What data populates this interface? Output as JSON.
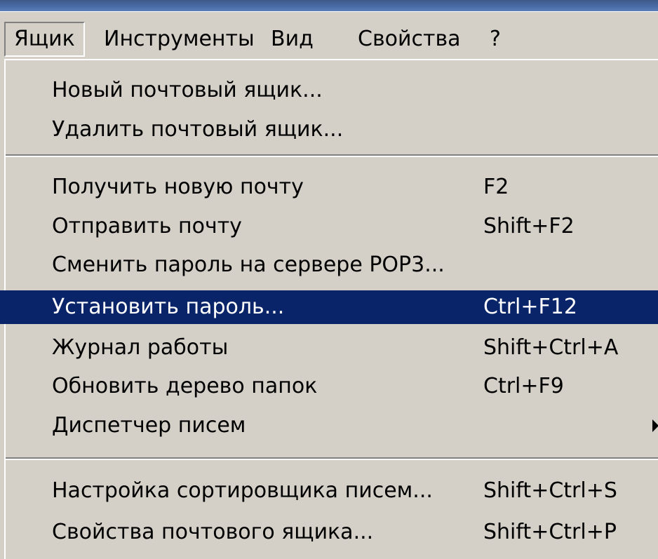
{
  "menubar": {
    "items": [
      {
        "label": "Ящик"
      },
      {
        "label": "Инструменты"
      },
      {
        "label": "Вид"
      },
      {
        "label": "Свойства"
      },
      {
        "label": "?"
      }
    ]
  },
  "menu": {
    "items": [
      {
        "label": "Новый почтовый ящик...",
        "shortcut": ""
      },
      {
        "label": "Удалить почтовый ящик...",
        "shortcut": ""
      },
      {
        "label": "Получить новую почту",
        "shortcut": "F2"
      },
      {
        "label": "Отправить почту",
        "shortcut": "Shift+F2"
      },
      {
        "label": "Сменить пароль на сервере POP3...",
        "shortcut": ""
      },
      {
        "label": "Установить пароль...",
        "shortcut": "Ctrl+F12",
        "highlighted": true
      },
      {
        "label": "Журнал работы",
        "shortcut": "Shift+Ctrl+A"
      },
      {
        "label": "Обновить дерево папок",
        "shortcut": "Ctrl+F9"
      },
      {
        "label": "Диспетчер писем",
        "shortcut": "",
        "submenu": true
      },
      {
        "label": "Настройка сортировщика писем...",
        "shortcut": "Shift+Ctrl+S"
      },
      {
        "label": "Свойства почтового ящика...",
        "shortcut": "Shift+Ctrl+P"
      }
    ]
  },
  "colors": {
    "menu_background": "#d4d0c8",
    "highlight_background": "#0a246a",
    "highlight_text": "#ffffff",
    "text": "#000000"
  },
  "icons": {
    "submenu_arrow": "submenu-arrow-icon"
  }
}
